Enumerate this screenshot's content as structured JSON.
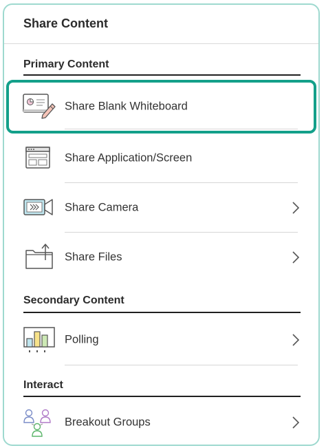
{
  "panel": {
    "title": "Share Content"
  },
  "sections": {
    "primary": "Primary Content",
    "secondary": "Secondary Content",
    "interact": "Interact"
  },
  "items": {
    "whiteboard": {
      "label": "Share Blank Whiteboard",
      "icon": "whiteboard-icon",
      "selected": true
    },
    "application": {
      "label": "Share Application/Screen",
      "icon": "application-screen-icon"
    },
    "camera": {
      "label": "Share Camera",
      "icon": "camera-icon",
      "has_submenu": true
    },
    "files": {
      "label": "Share Files",
      "icon": "files-icon",
      "has_submenu": true
    },
    "polling": {
      "label": "Polling",
      "icon": "polling-icon",
      "has_submenu": true
    },
    "breakout": {
      "label": "Breakout Groups",
      "icon": "breakout-groups-icon",
      "has_submenu": true
    }
  },
  "colors": {
    "selection_border": "#13a08a",
    "panel_border": "#9ed9cf",
    "text": "#333333"
  }
}
